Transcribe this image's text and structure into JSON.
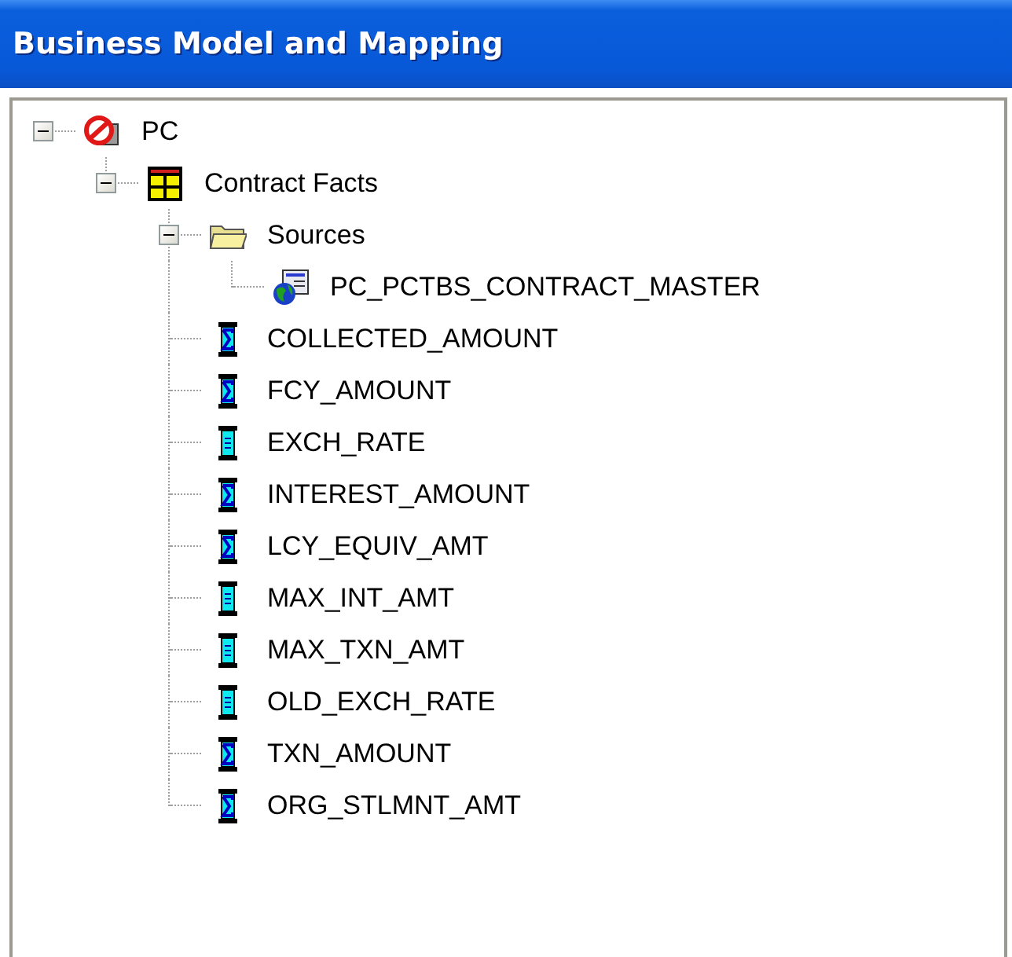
{
  "window": {
    "title": "Business Model and Mapping"
  },
  "tree": [
    {
      "label": "PC",
      "kind": "business-model",
      "expanded": true,
      "children": [
        {
          "label": "Contract Facts",
          "kind": "logical-table",
          "expanded": true,
          "children": [
            {
              "label": "Sources",
              "kind": "folder",
              "expanded": true,
              "children": [
                {
                  "label": "PC_PCTBS_CONTRACT_MASTER",
                  "kind": "source"
                }
              ]
            },
            {
              "label": "COLLECTED_AMOUNT",
              "kind": "measure"
            },
            {
              "label": "FCY_AMOUNT",
              "kind": "measure"
            },
            {
              "label": "EXCH_RATE",
              "kind": "column"
            },
            {
              "label": "INTEREST_AMOUNT",
              "kind": "measure"
            },
            {
              "label": "LCY_EQUIV_AMT",
              "kind": "measure"
            },
            {
              "label": "MAX_INT_AMT",
              "kind": "column"
            },
            {
              "label": "MAX_TXN_AMT",
              "kind": "column"
            },
            {
              "label": "OLD_EXCH_RATE",
              "kind": "column"
            },
            {
              "label": "TXN_AMOUNT",
              "kind": "measure"
            },
            {
              "label": "ORG_STLMNT_AMT",
              "kind": "measure"
            }
          ]
        }
      ]
    }
  ]
}
